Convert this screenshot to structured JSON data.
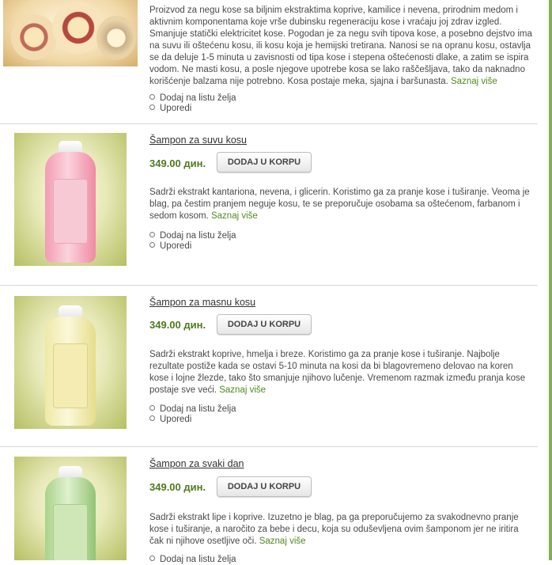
{
  "top_product": {
    "description": "Proizvod za negu kose sa biljnim ekstraktima koprive, kamilice i nevena, prirodnim medom i aktivnim komponentama koje vrše dubinsku regeneraciju kose i vraćaju joj zdrav izgled. Smanjuje statički elektricitet kose. Pogodan je za negu svih tipova kose, a posebno dejstvo ima na suvu ili oštećenu kosu, ili kosu koja je hemijski tretirana. Nanosi se na opranu kosu, ostavlja se da deluje 1-5 minuta u zavisnosti od tipa kose i stepena oštećenosti dlake, a zatim se ispira vodom. Ne masti kosu, a posle njegove upotrebe kosa se lako raščešljava, tako da naknadno korišćenje balzama nije potrebno. Kosa postaje meka, sjajna i baršunasta.",
    "more": "Saznaj više",
    "wishlist": "Dodaj na listu želja",
    "compare": "Uporedi"
  },
  "products": [
    {
      "title": "Šampon za suvu kosu",
      "price": "349.00 дин.",
      "button": "DODAJ U KORPU",
      "description": "Sadrži ekstrakt kantariona, nevena, i glicerin. Koristimo ga za pranje kose i tuširanje. Veoma je blag, pa čestim pranjem neguje kosu, te se preporučuje osobama sa oštećenom, farbanom i sedom kosom.",
      "more": "Saznaj više",
      "wishlist": "Dodaj na listu želja",
      "compare": "Uporedi"
    },
    {
      "title": "Šampon za masnu kosu",
      "price": "349.00 дин.",
      "button": "DODAJ U KORPU",
      "description": "Sadrži ekstrakt koprive, hmelja i breze. Koristimo ga za pranje kose i tuširanje. Najbolje rezultate postiže kada se ostavi 5-10 minuta na kosi da bi blagovremeno delovao na koren kose i lojne žlezde, tako što smanjuje njihovo lučenje. Vremenom razmak između pranja kose postaje sve veći.",
      "more": "Saznaj više",
      "wishlist": "Dodaj na listu želja",
      "compare": "Uporedi"
    },
    {
      "title": "Šampon za svaki dan",
      "price": "349.00 дин.",
      "button": "DODAJ U KORPU",
      "description": "Sadrži ekstrakt lipe i koprive. Izuzetno je blag, pa ga preporučujemo za svakodnevno pranje kose i tuširanje, a naročito za bebe i decu, koja su oduševljena ovim šamponom jer ne iritira čak ni njihove osetljive oči.",
      "more": "Saznaj više",
      "wishlist": "Dodaj na listu želja"
    }
  ],
  "colors": {
    "accent_green": "#4f7a1e",
    "link_green": "#4f8a1f",
    "rule_green": "#7fb15a"
  }
}
